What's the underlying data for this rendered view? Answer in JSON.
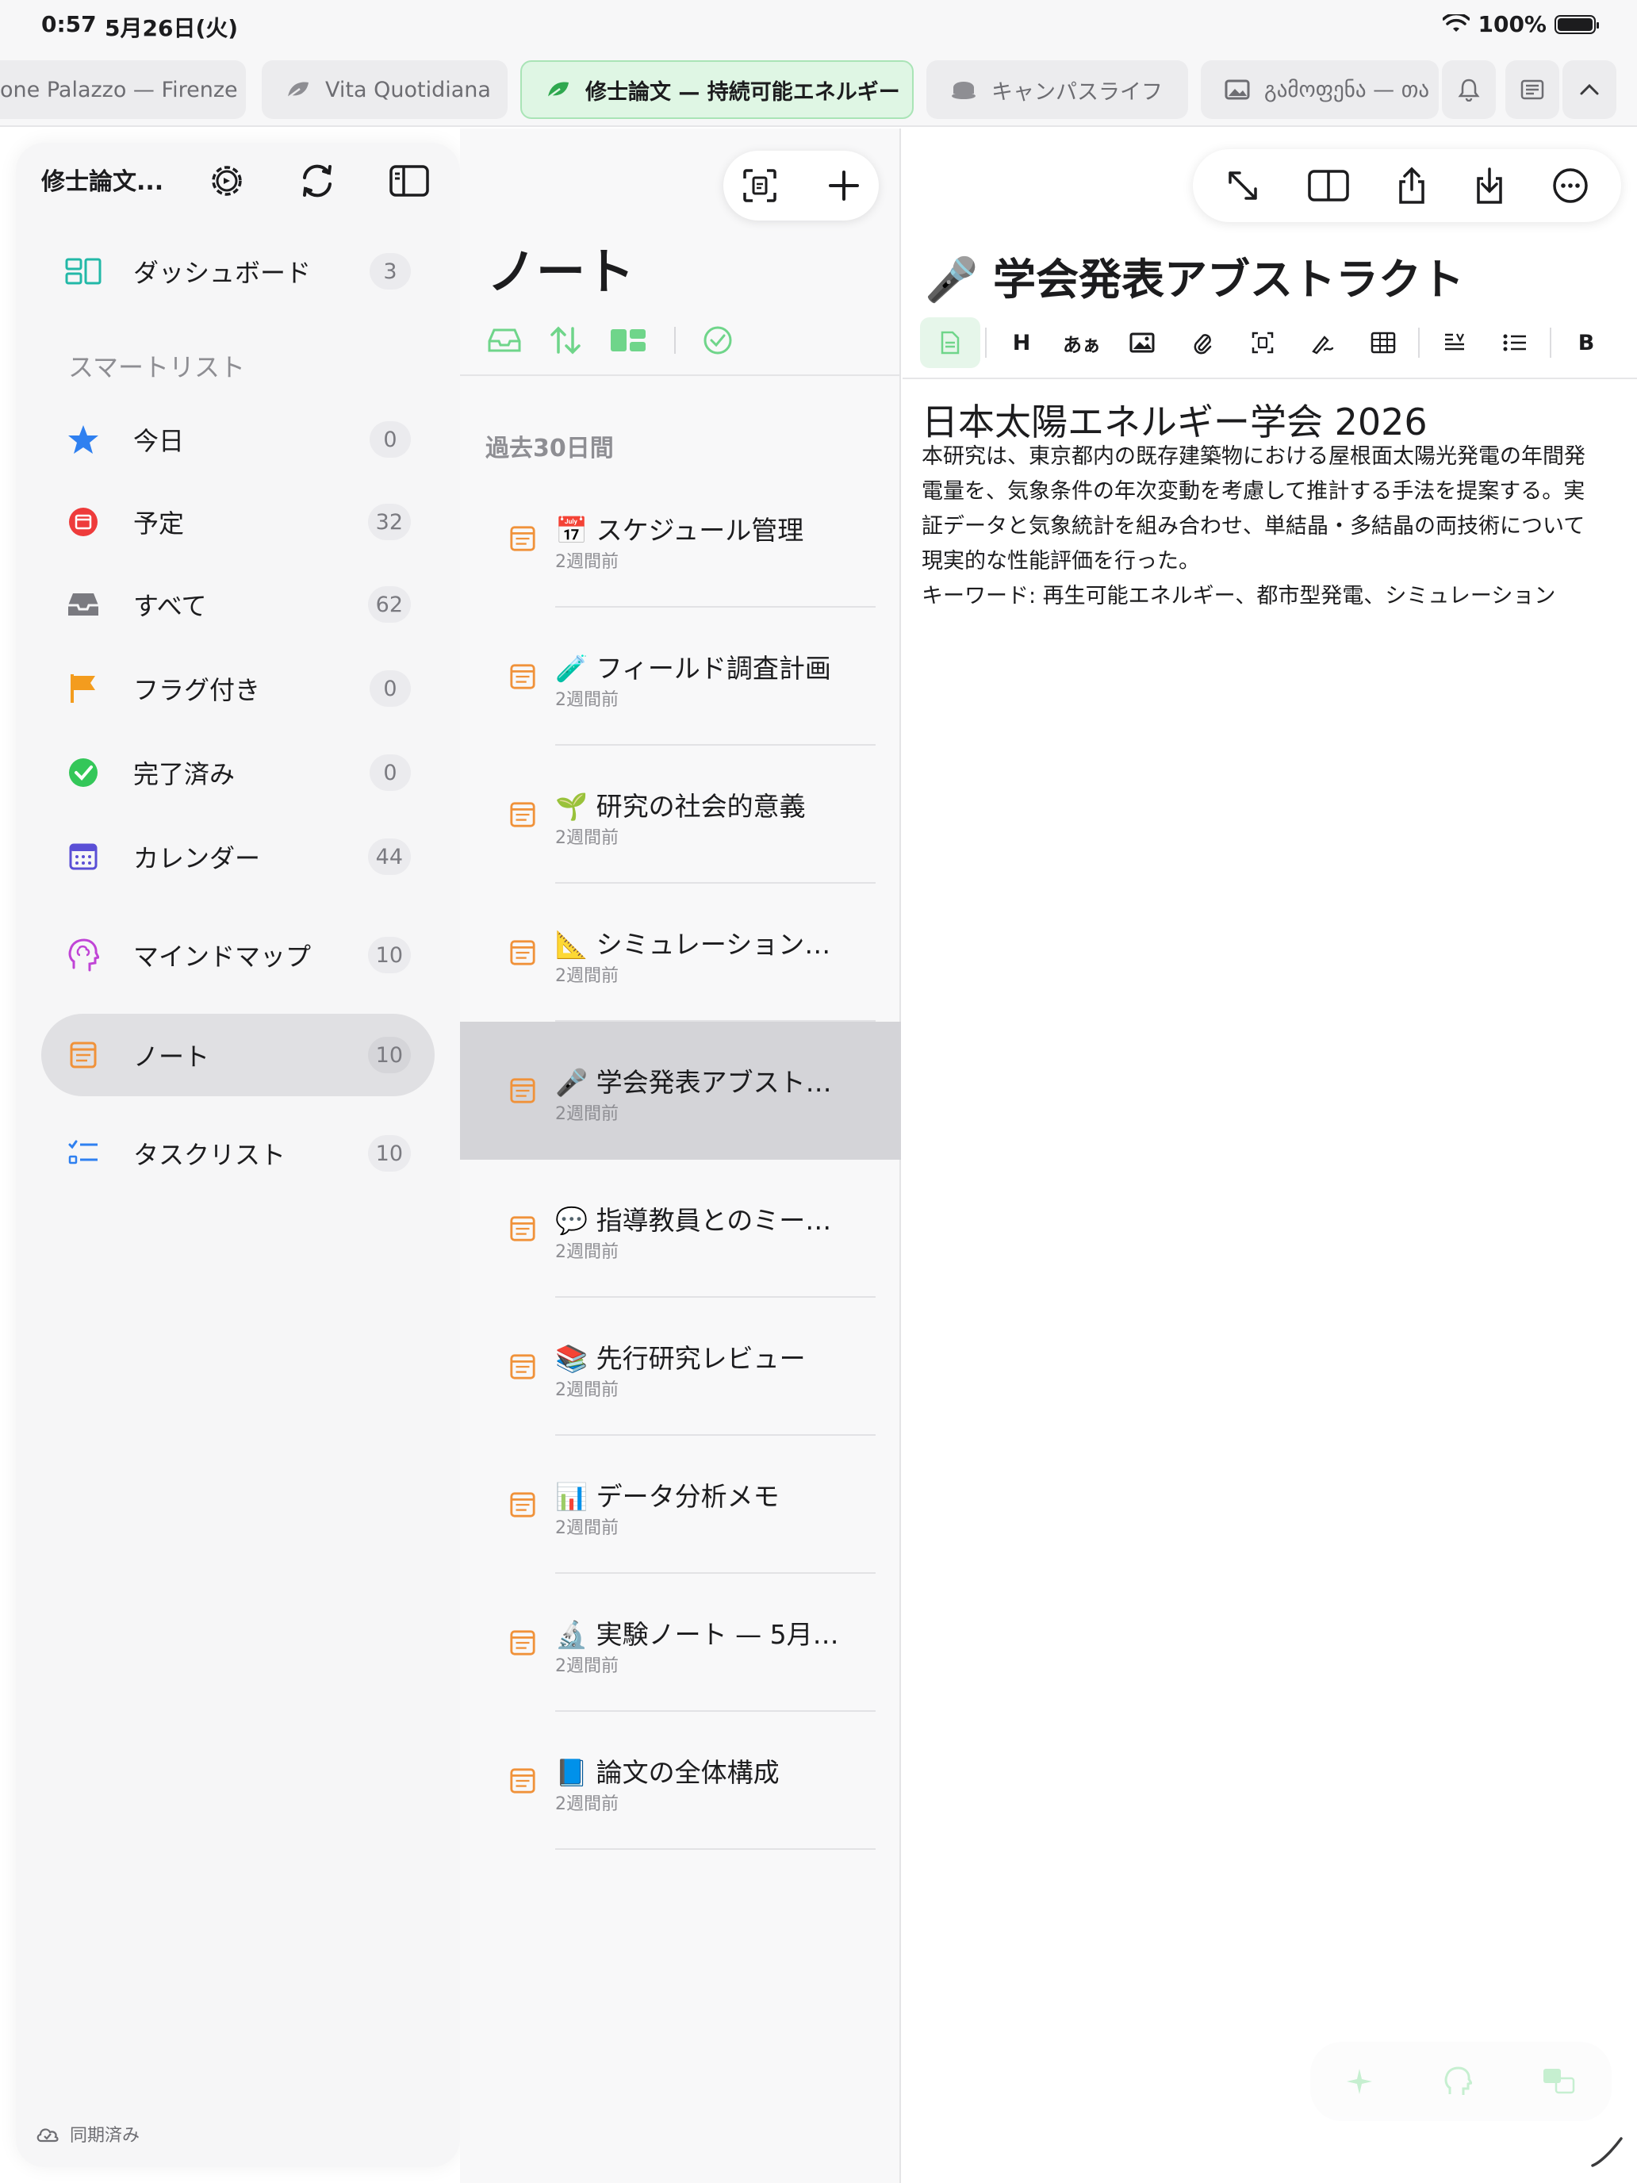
{
  "status": {
    "time": "0:57",
    "date": "5月26日(火)",
    "battery": "100%"
  },
  "tabs": [
    {
      "label": "one Palazzo — Firenze",
      "icon": "none"
    },
    {
      "label": "Vita Quotidiana",
      "icon": "leaf-icon"
    },
    {
      "label": "修士論文 — 持続可能エネルギー",
      "icon": "leaf-icon",
      "active": true
    },
    {
      "label": "キャンパスライフ",
      "icon": "coffee-icon"
    },
    {
      "label": "გამოფენა — თა",
      "icon": "image-icon"
    }
  ],
  "sidebar": {
    "title": "修士論文...",
    "dashboard": {
      "label": "ダッシュボード",
      "count": "3"
    },
    "section_label": "スマートリスト",
    "items": [
      {
        "label": "今日",
        "count": "0",
        "icon": "star-icon"
      },
      {
        "label": "予定",
        "count": "32",
        "icon": "calendar-red-icon"
      },
      {
        "label": "すべて",
        "count": "62",
        "icon": "inbox-icon"
      },
      {
        "label": "フラグ付き",
        "count": "0",
        "icon": "flag-icon"
      },
      {
        "label": "完了済み",
        "count": "0",
        "icon": "check-circle-icon"
      },
      {
        "label": "カレンダー",
        "count": "44",
        "icon": "calendar-grid-icon"
      },
      {
        "label": "マインドマップ",
        "count": "10",
        "icon": "brain-icon"
      },
      {
        "label": "ノート",
        "count": "10",
        "icon": "note-icon",
        "active": true
      },
      {
        "label": "タスクリスト",
        "count": "10",
        "icon": "checklist-icon"
      }
    ],
    "sync_status": "同期済み"
  },
  "notes_list": {
    "heading": "ノート",
    "group_label": "過去30日間",
    "items": [
      {
        "emoji": "📅",
        "title": "スケジュール管理",
        "time": "2週間前"
      },
      {
        "emoji": "🧪",
        "title": "フィールド調査計画",
        "time": "2週間前"
      },
      {
        "emoji": "🌱",
        "title": "研究の社会的意義",
        "time": "2週間前"
      },
      {
        "emoji": "📐",
        "title": "シミュレーション…",
        "time": "2週間前"
      },
      {
        "emoji": "🎤",
        "title": "学会発表アブスト…",
        "time": "2週間前",
        "selected": true
      },
      {
        "emoji": "💬",
        "title": "指導教員とのミー…",
        "time": "2週間前"
      },
      {
        "emoji": "📚",
        "title": "先行研究レビュー",
        "time": "2週間前"
      },
      {
        "emoji": "📊",
        "title": "データ分析メモ",
        "time": "2週間前"
      },
      {
        "emoji": "🔬",
        "title": "実験ノート — 5月…",
        "time": "2週間前"
      },
      {
        "emoji": "📘",
        "title": "論文の全体構成",
        "time": "2週間前"
      }
    ]
  },
  "editor": {
    "title": "🎤 学会発表アブストラクト",
    "format_bar": [
      "H",
      "あぁ",
      "B"
    ],
    "heading": "日本太陽エネルギー学会 2026",
    "body_lines": [
      "本研究は、東京都内の既存建築物における屋根面太陽光発電の年間発",
      "電量を、気象条件の年次変動を考慮して推計する手法を提案する。実",
      "証データと気象統計を組み合わせ、単結晶・多結晶の両技術について",
      "現実的な性能評価を行った。",
      "キーワード: 再生可能エネルギー、都市型発電、シミュレーション"
    ]
  },
  "colors": {
    "accent_green": "#34c759",
    "note_orange": "#f0923a",
    "selected_row": "#d4d4d8"
  }
}
